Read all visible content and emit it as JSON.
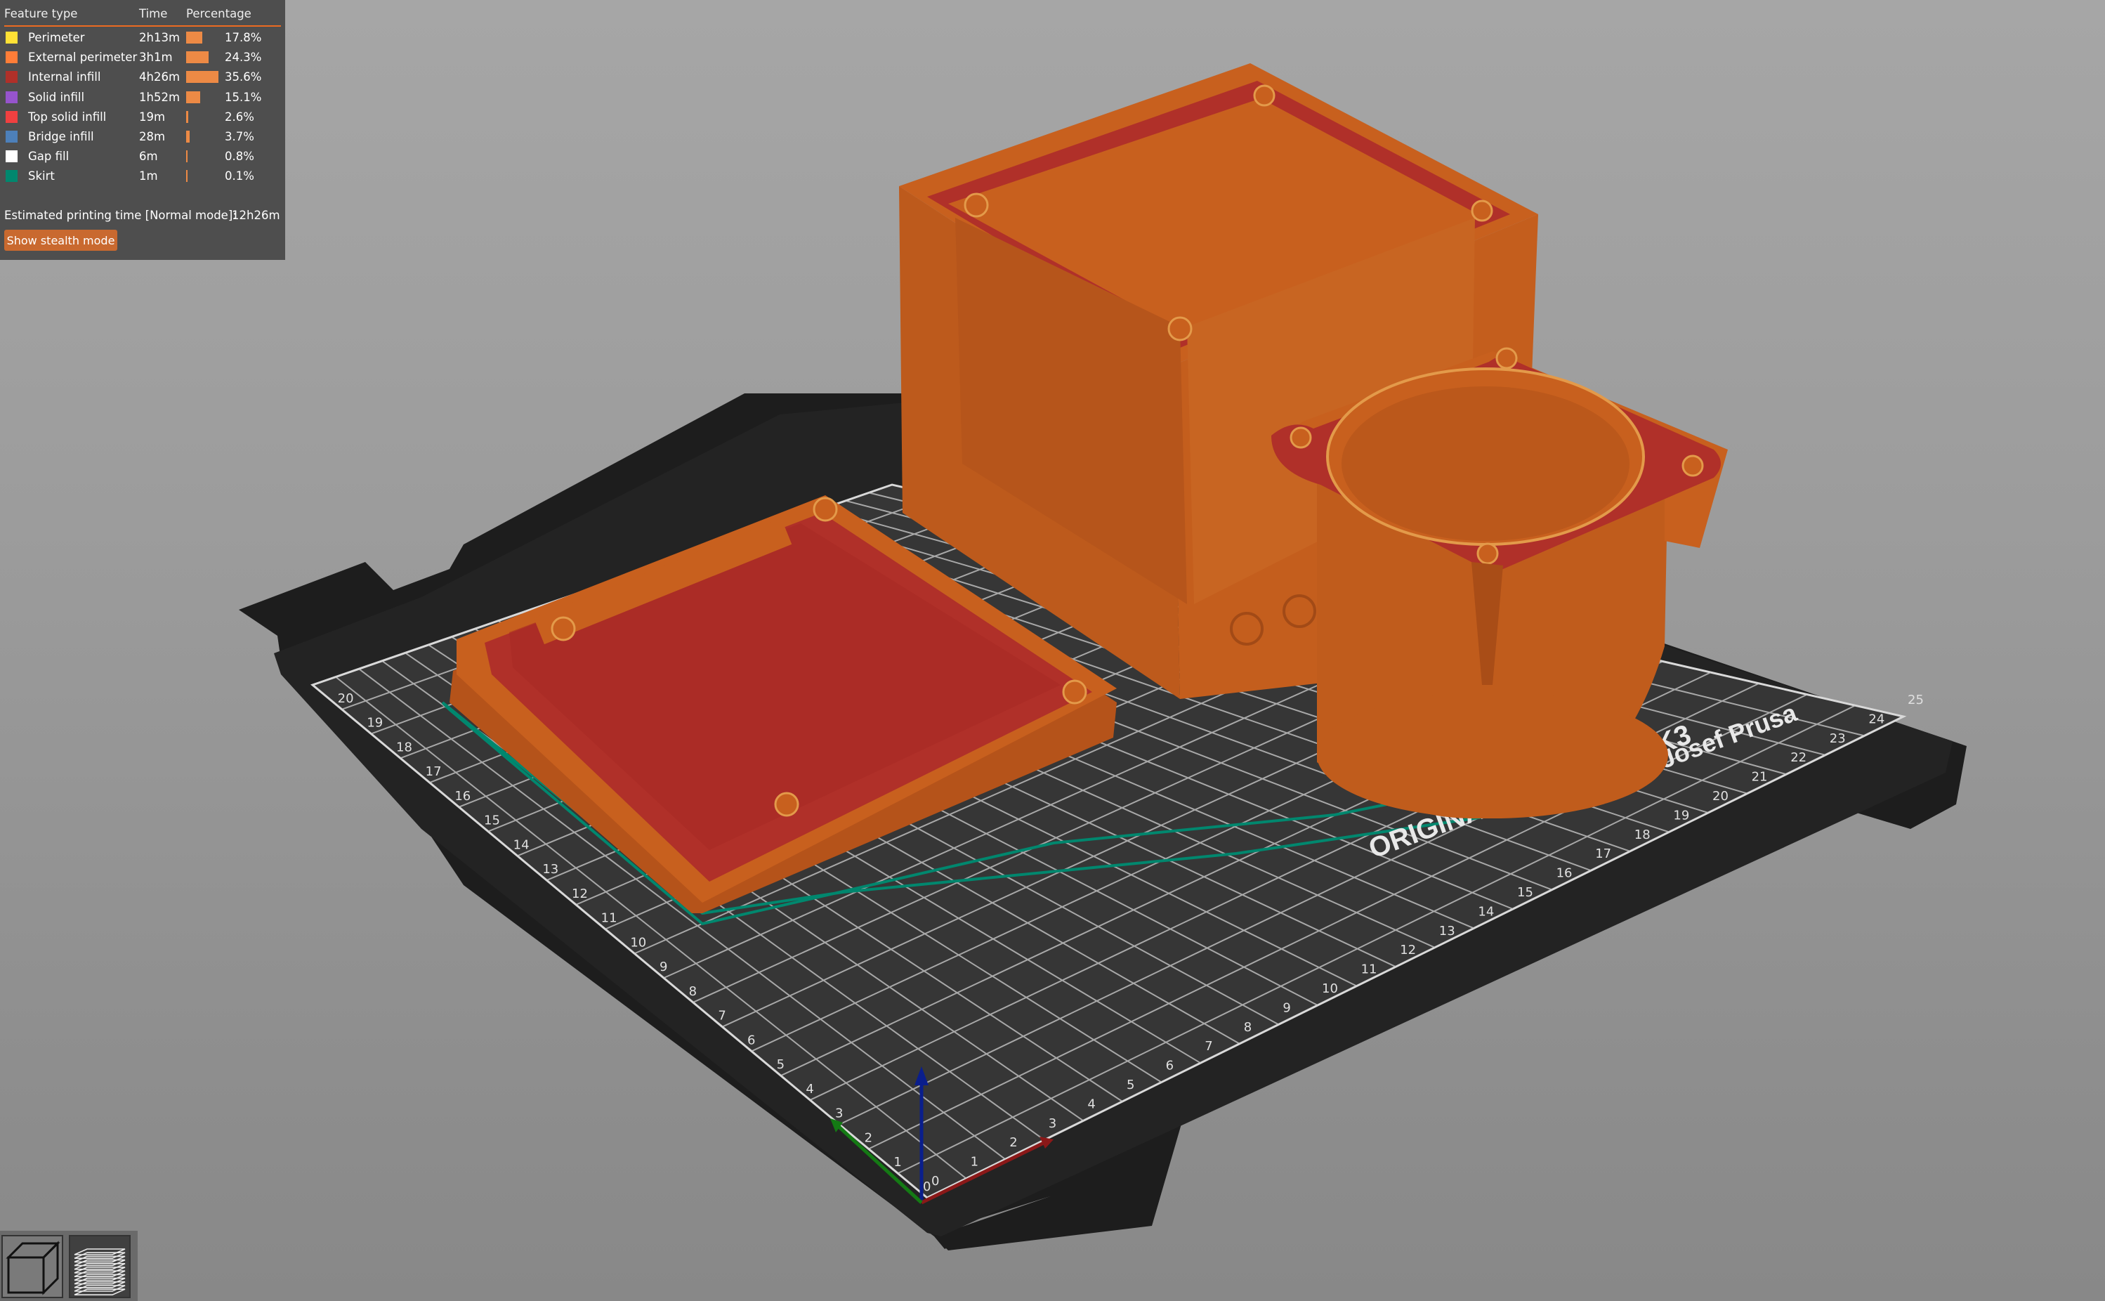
{
  "legend": {
    "headers": {
      "feature": "Feature type",
      "time": "Time",
      "percentage": "Percentage"
    },
    "rows": [
      {
        "name": "Perimeter",
        "time": "2h13m",
        "pct": "17.8%",
        "color": "#ffe135",
        "fraction": 0.178
      },
      {
        "name": "External perimeter",
        "time": "3h1m",
        "pct": "24.3%",
        "color": "#ff7d38",
        "fraction": 0.243
      },
      {
        "name": "Internal infill",
        "time": "4h26m",
        "pct": "35.6%",
        "color": "#b03029",
        "fraction": 0.356
      },
      {
        "name": "Solid infill",
        "time": "1h52m",
        "pct": "15.1%",
        "color": "#9654cc",
        "fraction": 0.151
      },
      {
        "name": "Top solid infill",
        "time": "19m",
        "pct": "2.6%",
        "color": "#f04040",
        "fraction": 0.026
      },
      {
        "name": "Bridge infill",
        "time": "28m",
        "pct": "3.7%",
        "color": "#4d80ba",
        "fraction": 0.037
      },
      {
        "name": "Gap fill",
        "time": "6m",
        "pct": "0.8%",
        "color": "#ffffff",
        "fraction": 0.008
      },
      {
        "name": "Skirt",
        "time": "1m",
        "pct": "0.1%",
        "color": "#00876e",
        "fraction": 0.001
      }
    ],
    "estimated_label": "Estimated printing time [Normal mode]:",
    "estimated_value": "12h26m",
    "stealth_button": "Show stealth mode"
  },
  "bed": {
    "brand_line1": "ORIGINAL PRUSA i3 MK3",
    "brand_line2": "by Josef Prusa",
    "axis_labels_front": [
      "0",
      "1",
      "2",
      "3",
      "4",
      "5",
      "6",
      "7",
      "8",
      "9",
      "10",
      "11",
      "12",
      "13",
      "14",
      "15",
      "16",
      "17",
      "18",
      "19",
      "20",
      "21",
      "22",
      "23",
      "24",
      "25"
    ],
    "axis_labels_side": [
      "0",
      "1",
      "2",
      "3",
      "4",
      "5",
      "6",
      "7",
      "8",
      "9",
      "10",
      "11",
      "12",
      "13",
      "14",
      "15",
      "16",
      "17",
      "18",
      "19",
      "20"
    ]
  },
  "colors": {
    "filament": "#c8601e",
    "infill": "#b03029",
    "bed": "#2a2a2a",
    "bed_sheet": "#3a3a3a",
    "accent": "#ed6b21"
  },
  "toolbar": {
    "view_3d_icon": "cube-icon",
    "preview_layers_icon": "layers-icon"
  }
}
